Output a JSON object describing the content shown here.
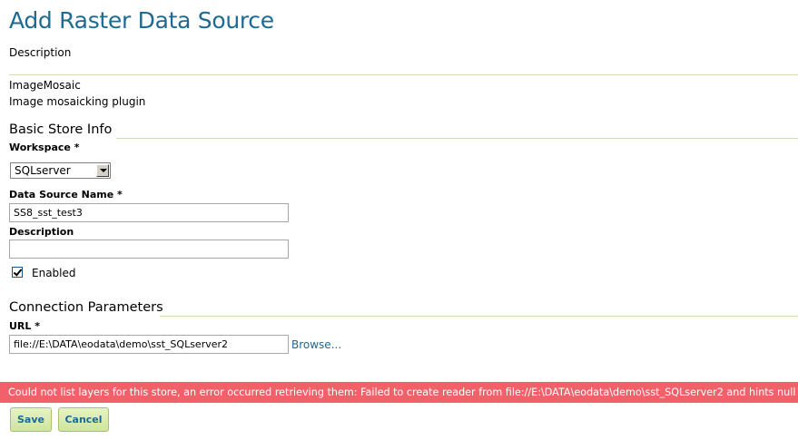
{
  "page": {
    "title": "Add Raster Data Source",
    "description_label": "Description"
  },
  "plugin": {
    "name": "ImageMosaic",
    "description": "Image mosaicking plugin"
  },
  "basic_store_info": {
    "heading": "Basic Store Info",
    "workspace_label": "Workspace *",
    "workspace_value": "SQLserver",
    "data_source_name_label": "Data Source Name *",
    "data_source_name_value": "SS8_sst_test3",
    "description_label": "Description",
    "description_value": "",
    "enabled_label": "Enabled",
    "enabled_checked": true
  },
  "connection_parameters": {
    "heading": "Connection Parameters",
    "url_label": "URL *",
    "url_value": "file://E:\\DATA\\eodata\\demo\\sst_SQLserver2",
    "browse_label": "Browse..."
  },
  "error_message": "Could not list layers for this store, an error occurred retrieving them: Failed to create reader from file://E:\\DATA\\eodata\\demo\\sst_SQLserver2 and hints null",
  "actions": {
    "save_label": "Save",
    "cancel_label": "Cancel"
  },
  "colors": {
    "title": "#1d6a93",
    "divider": "#cddfb3",
    "error_bg": "#f0616a",
    "button_bg": "#d4e9a8"
  },
  "icons": {
    "checkbox": "checkmark-icon",
    "dropdown": "chevron-down-icon"
  }
}
